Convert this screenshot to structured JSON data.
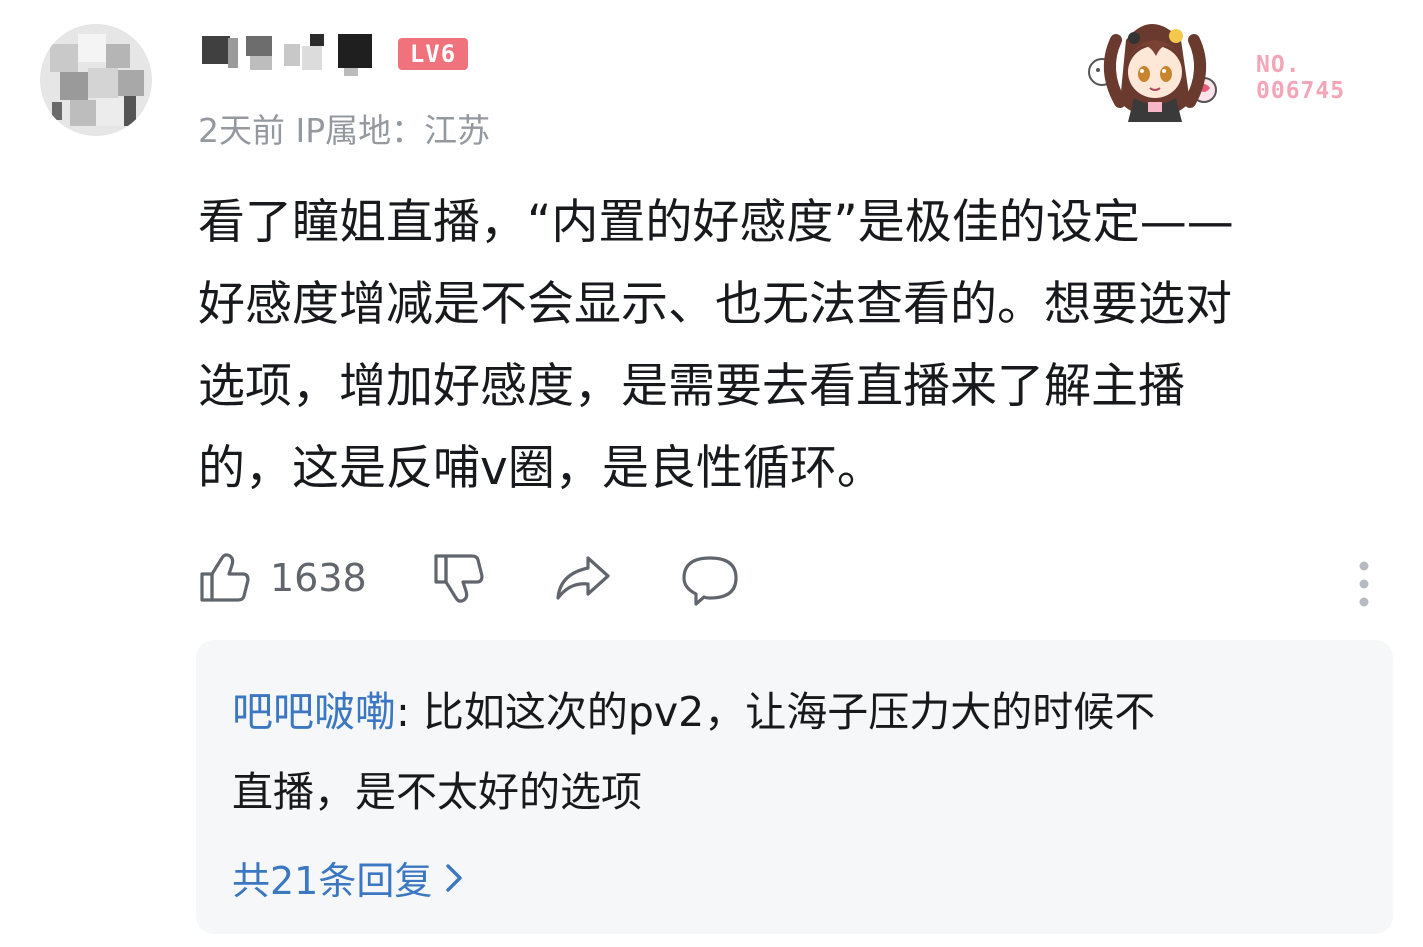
{
  "comment": {
    "level_badge": "LV6",
    "time": "2天前",
    "ip_location": "IP属地：江苏",
    "fan_badge_number": "NO.\n006745",
    "body": "看了瞳姐直播，“内置的好感度”是极佳的设定——\n好感度增减是不会显示、也无法查看的。想要选对\n选项，增加好感度，是需要去看直播来了解主播\n的，这是反哺v圈，是良性循环。",
    "like_count": "1638",
    "icons": [
      "like-icon",
      "dislike-icon",
      "share-icon",
      "reply-icon",
      "more-icon"
    ]
  },
  "reply_preview": {
    "author": "吧吧啵嘞",
    "separator": ": ",
    "text": "比如这次的pv2，让海子压力大的时候不\n直播，是不太好的选项",
    "view_more": "共21条回复"
  },
  "colors": {
    "link_blue": "#3b78c1",
    "meta_gray": "#9499a0",
    "level_badge": "#f0727d",
    "reply_bg": "#f6f7f8",
    "fan_badge_pink": "#f5a5b8"
  }
}
